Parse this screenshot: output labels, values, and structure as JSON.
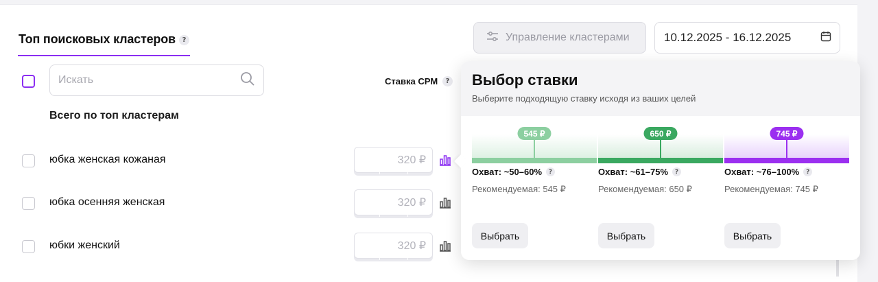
{
  "section": {
    "title": "Топ поисковых кластеров",
    "help": "?"
  },
  "toolbar": {
    "manage_label": "Управление кластерами",
    "date_range": "10.12.2025 - 16.12.2025"
  },
  "search": {
    "placeholder": "Искать"
  },
  "table": {
    "cpm_header": "Ставка CPM",
    "cpm_help": "?",
    "total_label": "Всего по топ кластерам",
    "rows": [
      {
        "name": "юбка женская кожаная",
        "bid": "320 ₽"
      },
      {
        "name": "юбка осенняя женская",
        "bid": "320 ₽"
      },
      {
        "name": "юбки женский",
        "bid": "320 ₽"
      }
    ]
  },
  "popover": {
    "title": "Выбор ставки",
    "subtitle": "Выберите подходящую ставку исходя из ваших целей",
    "options": [
      {
        "price": "545 ₽",
        "reach": "Охват: ~50–60%",
        "recommended": "Рекомендуемая: 545 ₽",
        "button": "Выбрать",
        "color": "#8ccfa0"
      },
      {
        "price": "650 ₽",
        "reach": "Охват: ~61–75%",
        "recommended": "Рекомендуемая: 650 ₽",
        "button": "Выбрать",
        "color": "#3aa860"
      },
      {
        "price": "745 ₽",
        "reach": "Охват: ~76–100%",
        "recommended": "Рекомендуемая: 745 ₽",
        "button": "Выбрать",
        "color": "#9b2ff0"
      }
    ],
    "help": "?"
  },
  "colors": {
    "accent": "#8b2ef2",
    "green_light": "#8ccfa0",
    "green": "#3aa860",
    "purple": "#9b2ff0"
  }
}
